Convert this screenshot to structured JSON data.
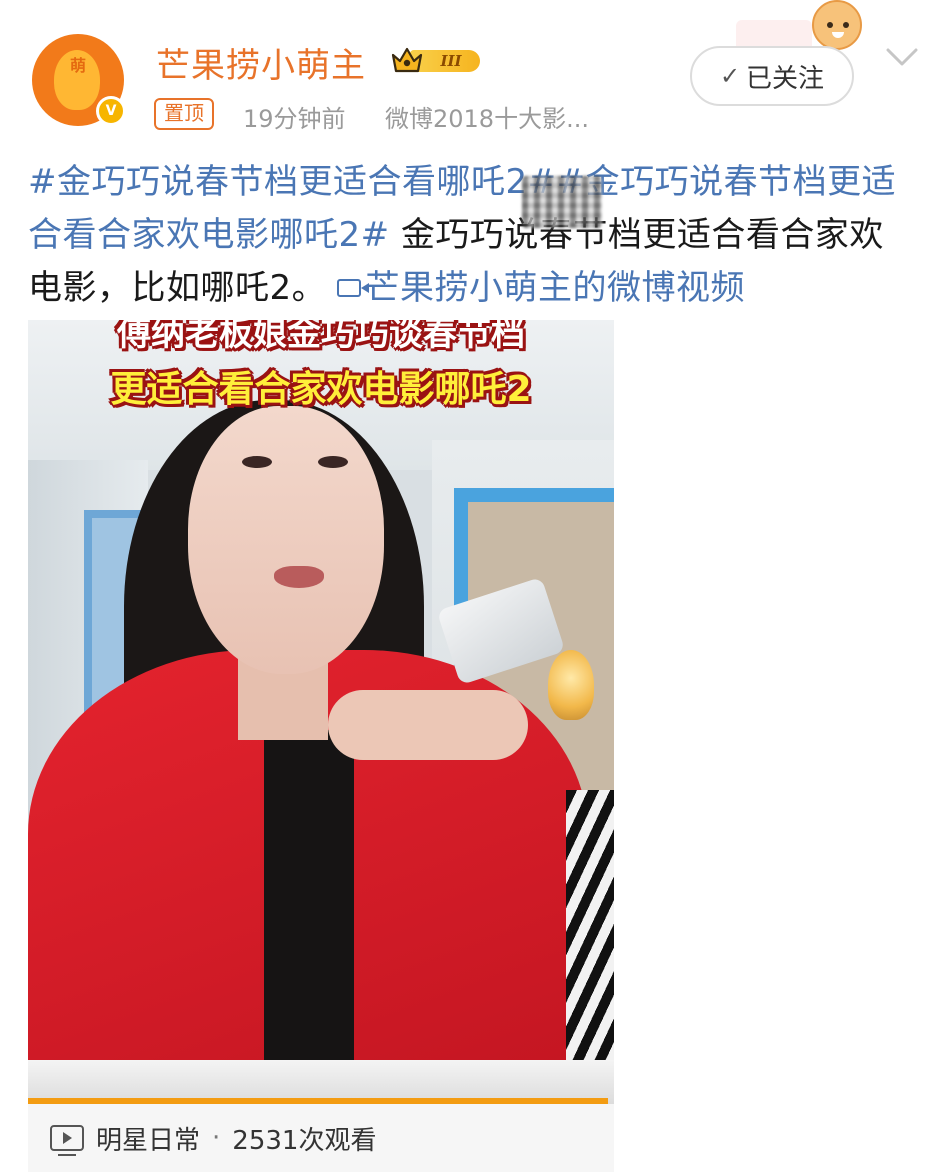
{
  "header": {
    "username": "芒果捞小萌主",
    "vip_level": "III",
    "pin_label": "置顶",
    "time": "19分钟前",
    "source": "微博2018十大影...",
    "follow_label": "已关注",
    "follow_check": "✓",
    "avatar_text": "萌"
  },
  "post": {
    "hashtag_1": "#金巧巧说春节档更适合看哪吒2#",
    "hashtag_2": "#金巧巧说春节档更适合看合家欢电影哪吒2#",
    "body": " 金巧巧说春节档更适合看合家欢电影，比如哪吒2。",
    "video_link": "芒果捞小萌主的微博视频"
  },
  "video": {
    "caption_line_1": "傅纳老板娘金巧巧谈春节档",
    "caption_line_2": "更适合看合家欢电影哪吒2",
    "progress": 0.99
  },
  "footer": {
    "category": "明星日常",
    "separator": "·",
    "views": "2531次观看"
  },
  "colors": {
    "username": "#e8732a",
    "hashtag": "#4a76b4",
    "meta": "#9a9a9a",
    "progress": "#f39c12",
    "caption_fill": "#ffef3a",
    "caption_stroke": "#9a1313"
  },
  "icons": [
    "crown-icon",
    "verified-icon",
    "chevron-down-icon",
    "video-link-icon",
    "video-play-icon"
  ]
}
